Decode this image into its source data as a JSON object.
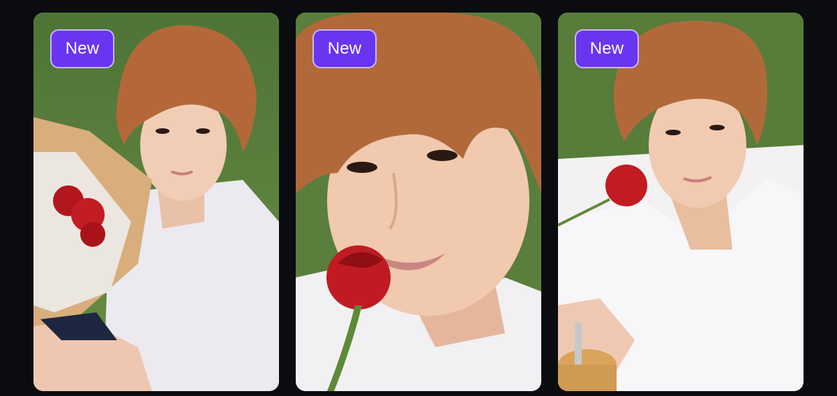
{
  "cards": [
    {
      "badge": "New",
      "subject": "photocard-bouquet"
    },
    {
      "badge": "New",
      "subject": "photocard-rose-closeup"
    },
    {
      "badge": "New",
      "subject": "photocard-rose-lying"
    }
  ],
  "colors": {
    "background": "#0b0c0f",
    "badge_fill": "#6a35f0",
    "badge_border": "#c9b8ff",
    "badge_text": "#ffffff"
  }
}
